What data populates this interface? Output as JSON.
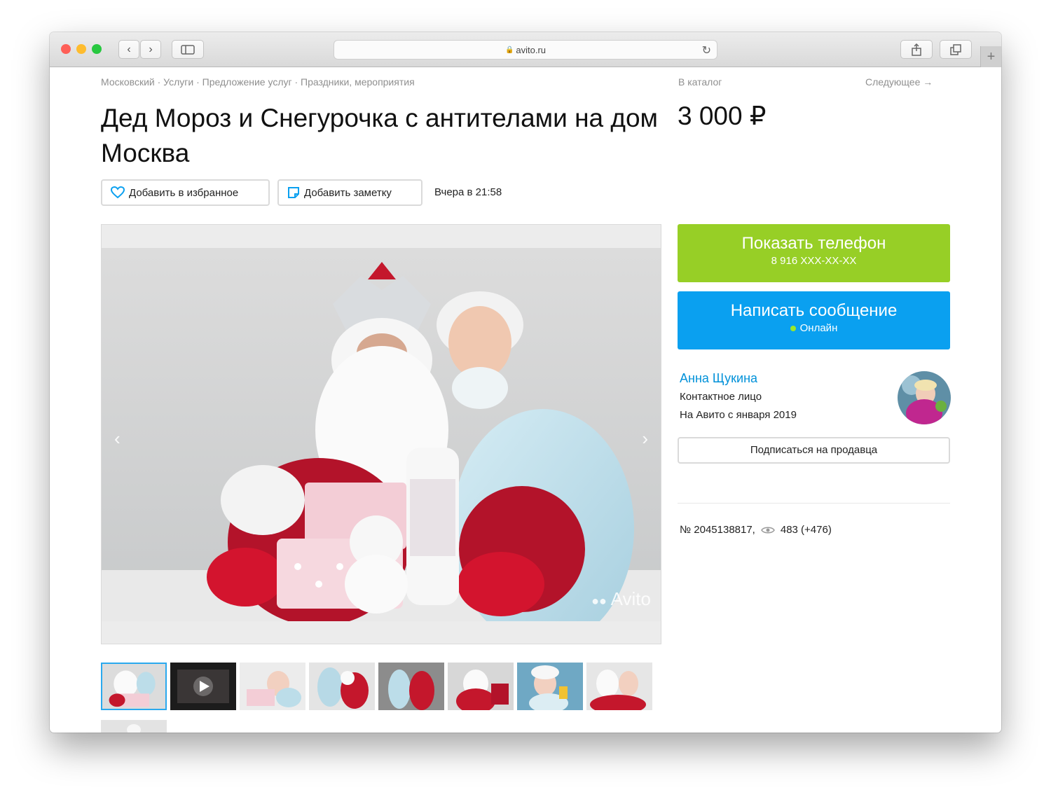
{
  "browser": {
    "url": "avito.ru",
    "lock_icon": "🔒",
    "traffic_lights": [
      "#fe5f57",
      "#febc2e",
      "#28c840"
    ]
  },
  "breadcrumbs": "Московский · Услуги · Предложение услуг · Праздники, мероприятия",
  "catalog_link": "В каталог",
  "next_link": "Следующее →",
  "listing": {
    "title": "Дед Мороз и Снегурочка с антителами на дом Москва",
    "price": "3 000 ₽",
    "favorite_label": "Добавить в избранное",
    "note_label": "Добавить заметку",
    "date": "Вчера в 21:58",
    "watermark": "Avito",
    "number_text": "№ 2045138817,",
    "views_text": "483 (+476)"
  },
  "contact": {
    "phone_label": "Показать телефон",
    "phone_masked": "8 916 XXX-XX-XX",
    "message_label": "Написать сообщение",
    "status": "Онлайн",
    "phone_color": "#97cf26",
    "message_color": "#0aa0f0"
  },
  "seller": {
    "name": "Анна Щукина",
    "role": "Контактное лицо",
    "since": "На Авито с января 2019",
    "subscribe_label": "Подписаться на продавца"
  },
  "icons": {
    "heart": "heart-icon",
    "note": "note-icon",
    "eye": "eye-icon",
    "prev": "chevron-left-icon",
    "next": "chevron-right-icon"
  }
}
